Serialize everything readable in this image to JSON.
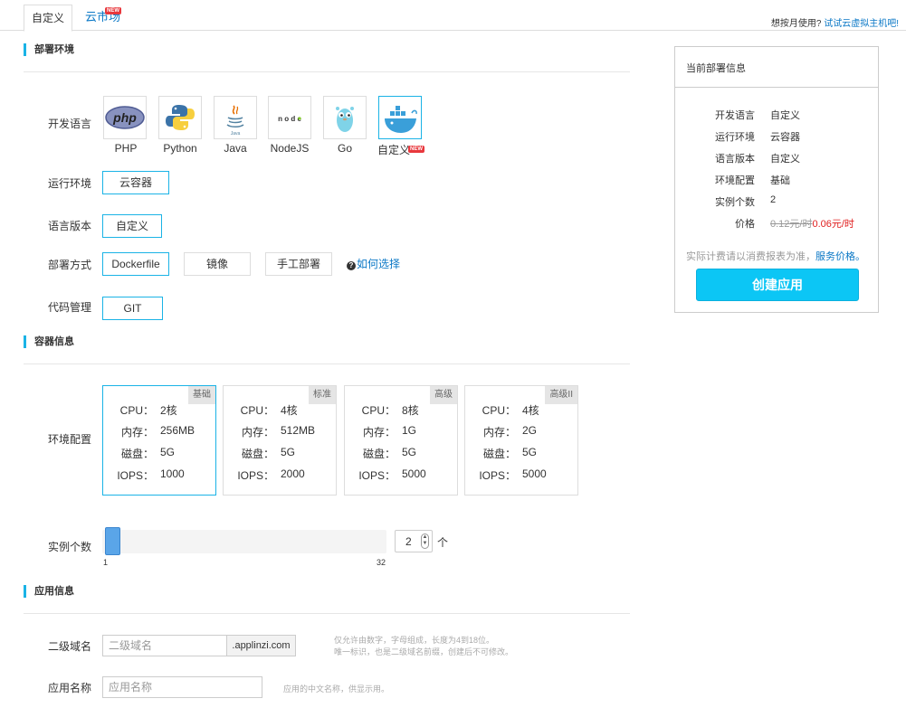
{
  "tabs": {
    "custom": "自定义",
    "market": "云市场",
    "market_badge": "NEW"
  },
  "top_right": {
    "question": "想按月使用?",
    "link": "试试云虚拟主机吧!"
  },
  "sections": {
    "deploy_env": "部署环境",
    "container_info": "容器信息",
    "app_info": "应用信息"
  },
  "labels": {
    "dev_language": "开发语言",
    "runtime": "运行环境",
    "lang_version": "语言版本",
    "deploy_method": "部署方式",
    "code_mgmt": "代码管理",
    "env_config": "环境配置",
    "instance_count": "实例个数",
    "subdomain": "二级域名",
    "app_name": "应用名称"
  },
  "languages": [
    {
      "name": "PHP",
      "icon": "php-icon"
    },
    {
      "name": "Python",
      "icon": "python-icon"
    },
    {
      "name": "Java",
      "icon": "java-icon"
    },
    {
      "name": "NodeJS",
      "icon": "nodejs-icon"
    },
    {
      "name": "Go",
      "icon": "go-gopher-icon"
    },
    {
      "name": "自定义",
      "icon": "docker-whale-icon",
      "badge": "NEW",
      "selected": true
    }
  ],
  "runtime_option": "云容器",
  "version_option": "自定义",
  "deploy_options": [
    "Dockerfile",
    "镜像",
    "手工部署"
  ],
  "deploy_help": "如何选择",
  "code_option": "GIT",
  "specs": [
    {
      "tag": "基础",
      "cpu": "2核",
      "mem": "256MB",
      "disk": "5G",
      "iops": "1000",
      "selected": true
    },
    {
      "tag": "标准",
      "cpu": "4核",
      "mem": "512MB",
      "disk": "5G",
      "iops": "2000"
    },
    {
      "tag": "高级",
      "cpu": "8核",
      "mem": "1G",
      "disk": "5G",
      "iops": "5000"
    },
    {
      "tag": "高级II",
      "cpu": "4核",
      "mem": "2G",
      "disk": "5G",
      "iops": "5000"
    }
  ],
  "spec_keys": {
    "cpu": "CPU：",
    "mem": "内存：",
    "disk": "磁盘：",
    "iops": "IOPS："
  },
  "slider": {
    "min": "1",
    "max": "32",
    "value": "2",
    "unit": "个"
  },
  "subdomain": {
    "placeholder": "二级域名",
    "suffix": ".applinzi.com",
    "hint1": "仅允许由数字，字母组成，长度为4到18位。",
    "hint2": "唯一标识，也是二级域名前缀，创建后不可修改。"
  },
  "app_name": {
    "placeholder": "应用名称",
    "hint": "应用的中文名称，供显示用。"
  },
  "panel": {
    "title": "当前部署信息",
    "rows": [
      {
        "k": "开发语言",
        "v": "自定义"
      },
      {
        "k": "运行环境",
        "v": "云容器"
      },
      {
        "k": "语言版本",
        "v": "自定义"
      },
      {
        "k": "环境配置",
        "v": "基础"
      },
      {
        "k": "实例个数",
        "v": "2"
      }
    ],
    "price_label": "价格",
    "price_old": "0.12元/时",
    "price_new": "0.06元/时",
    "note": "实际计费请以消费报表为准，",
    "note_link": "服务价格。",
    "create_button": "创建应用"
  },
  "colors": {
    "accent": "#1ab3e6",
    "link": "#0b78c6",
    "button": "#0cc6f5",
    "price": "#e02020"
  }
}
